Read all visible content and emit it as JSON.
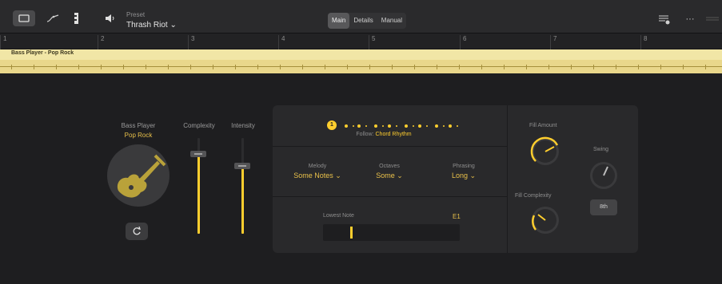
{
  "toolbar": {
    "preset_caption": "Preset",
    "preset_value": "Thrash Riot ⌄",
    "view_tabs": [
      "Main",
      "Details",
      "Manual"
    ],
    "active_tab": "Main",
    "more_label": "···",
    "icons": [
      "square-view-icon",
      "curve-editor-icon",
      "piano-keys-icon",
      "speaker-icon",
      "settings-sliders-icon",
      "more-icon",
      "drag-handle-icon"
    ]
  },
  "ruler": {
    "bars": [
      "1",
      "2",
      "3",
      "4",
      "5",
      "6",
      "7",
      "8"
    ]
  },
  "region": {
    "title": "Bass Player - Pop Rock",
    "color": "#f1e6a6"
  },
  "player": {
    "caption": "Bass Player",
    "value": "Pop Rock",
    "complexity_label": "Complexity",
    "complexity_value": 0.74,
    "intensity_label": "Intensity",
    "intensity_value": 0.66,
    "accent": "#ffce2e"
  },
  "pattern": {
    "step_badge": "1",
    "follow_label": "Follow:",
    "follow_value": "Chord Rhythm",
    "melody_label": "Melody",
    "melody_value": "Some Notes ⌄",
    "octaves_label": "Octaves",
    "octaves_value": "Some ⌄",
    "phrasing_label": "Phrasing",
    "phrasing_value": "Long ⌄",
    "lowest_note_label": "Lowest Note",
    "lowest_note_value": "E1"
  },
  "fills": {
    "fill_amount_label": "Fill Amount",
    "fill_complexity_label": "Fill Complexity",
    "swing_label": "Swing",
    "swing_button": "8th"
  }
}
